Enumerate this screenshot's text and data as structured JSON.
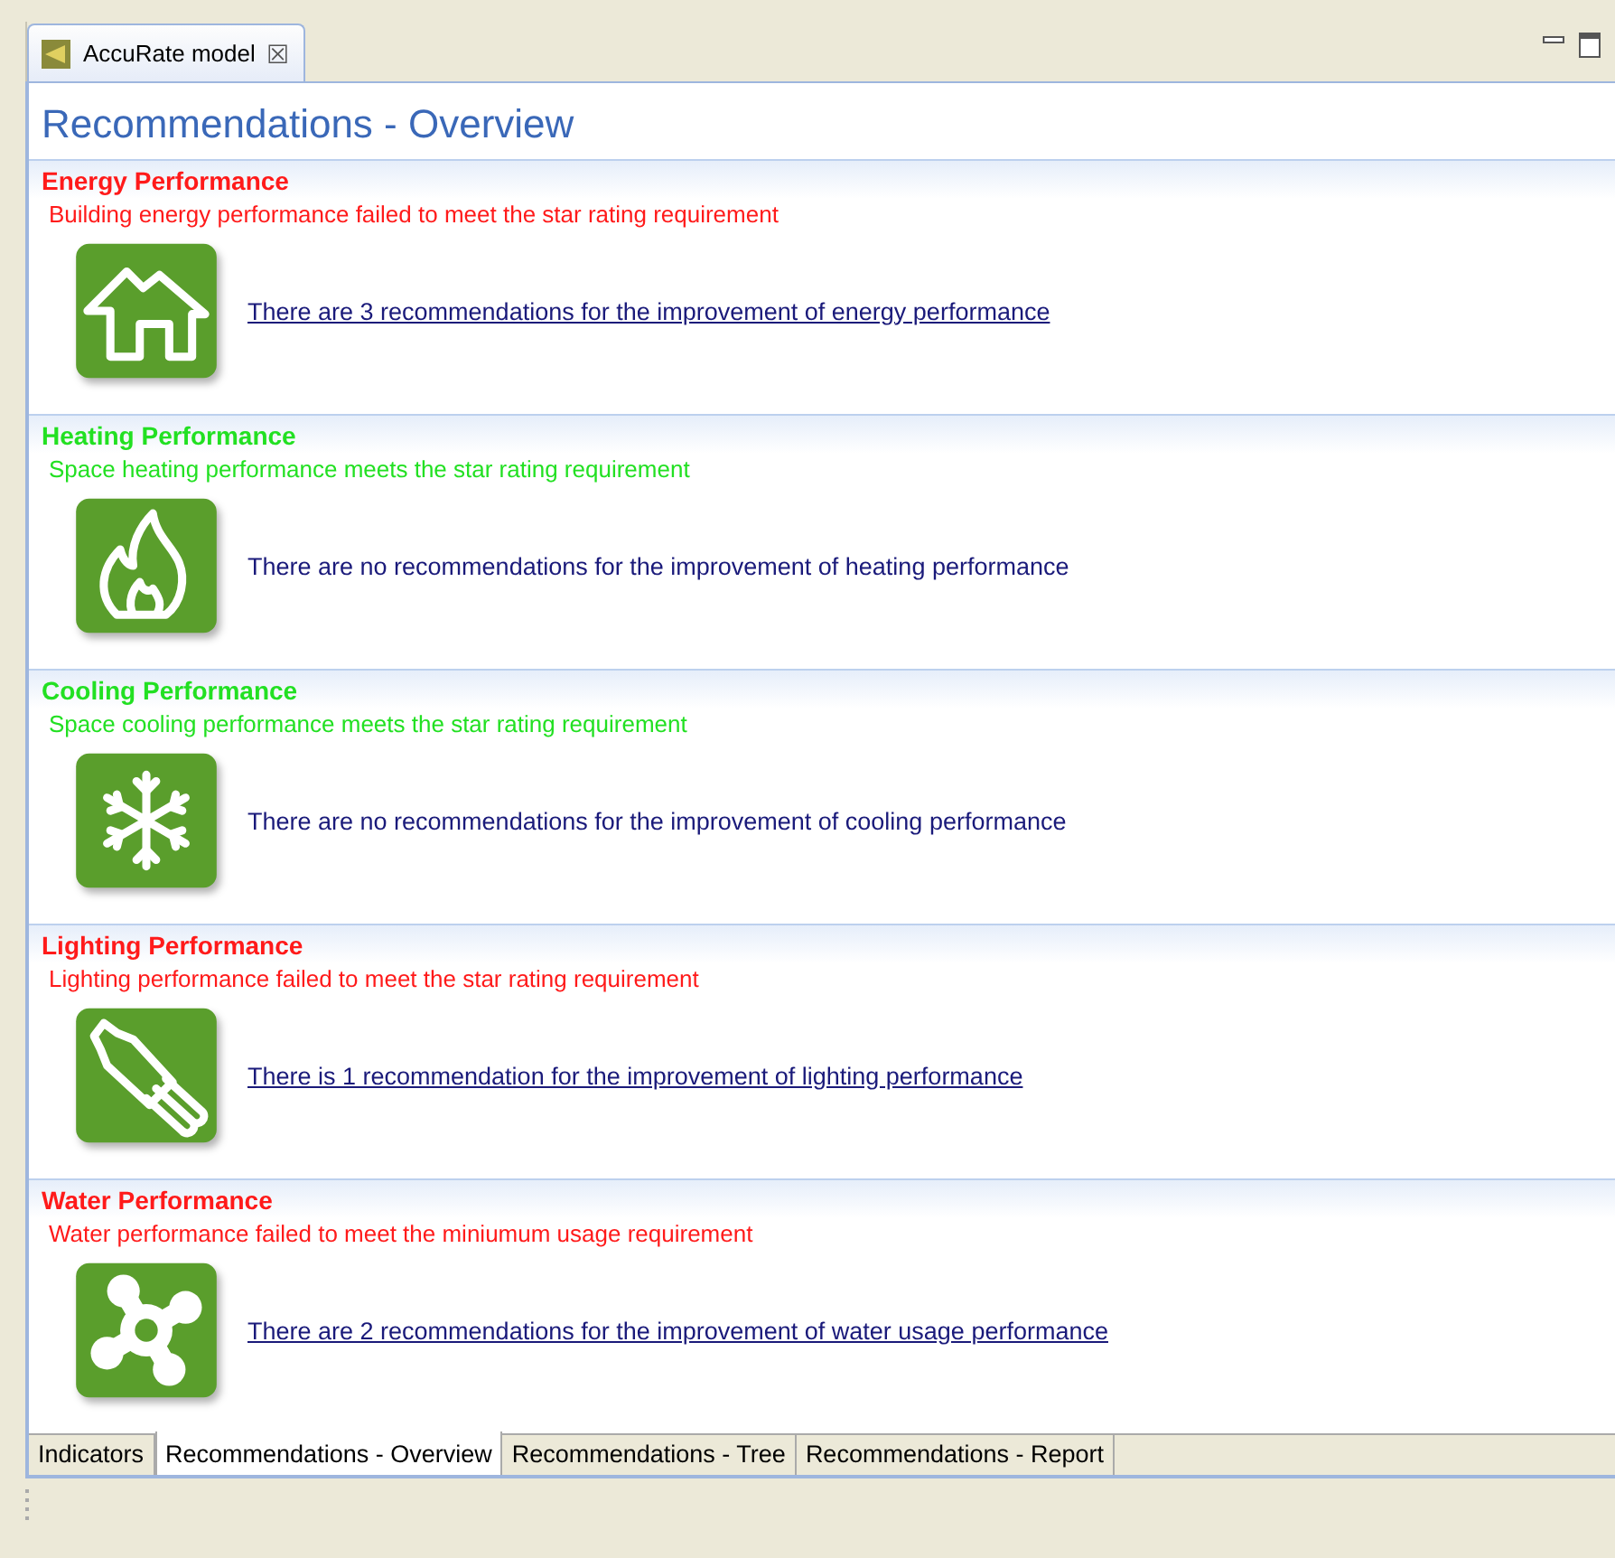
{
  "editor_tab": {
    "label": "AccuRate model",
    "close": "☒"
  },
  "page_title": "Recommendations - Overview",
  "sections": [
    {
      "title": "Energy Performance",
      "status": "Building energy performance failed to meet the star rating requirement",
      "passed": false,
      "kind": "house",
      "message": "There are 3 recommendations for the improvement of energy performance",
      "link": true
    },
    {
      "title": "Heating Performance",
      "status": "Space heating performance meets the star rating requirement",
      "passed": true,
      "kind": "flame",
      "message": "There are no recommendations for the improvement of heating performance",
      "link": false
    },
    {
      "title": "Cooling Performance",
      "status": "Space cooling performance meets the star rating requirement",
      "passed": true,
      "kind": "snowflake",
      "message": "There are no recommendations for the improvement of cooling performance",
      "link": false
    },
    {
      "title": "Lighting Performance",
      "status": "Lighting performance failed to meet the star rating requirement",
      "passed": false,
      "kind": "bulb",
      "message": "There is 1 recommendation for the improvement of lighting performance",
      "link": true
    },
    {
      "title": "Water Performance",
      "status": "Water performance failed to meet the miniumum usage requirement",
      "passed": false,
      "kind": "fan",
      "message": "There are 2 recommendations for the improvement of water usage performance",
      "link": true
    }
  ],
  "bottom_tabs": [
    {
      "label": "Indicators",
      "selected": false
    },
    {
      "label": "Recommendations - Overview",
      "selected": true
    },
    {
      "label": "Recommendations - Tree",
      "selected": false
    },
    {
      "label": "Recommendations - Report",
      "selected": false
    }
  ]
}
